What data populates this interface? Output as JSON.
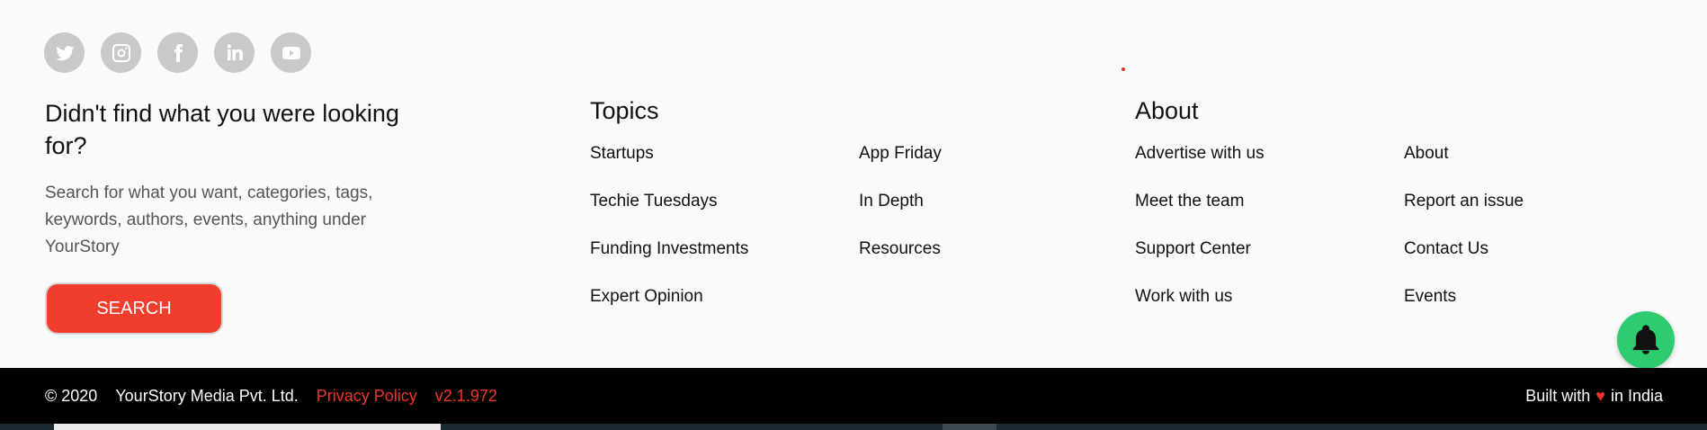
{
  "social": [
    {
      "name": "twitter-icon",
      "glyph": "twitter"
    },
    {
      "name": "instagram-icon",
      "glyph": "instagram"
    },
    {
      "name": "facebook-icon",
      "glyph": "f"
    },
    {
      "name": "linkedin-icon",
      "glyph": "in"
    },
    {
      "name": "youtube-icon",
      "glyph": "youtube"
    }
  ],
  "search": {
    "heading": "Didn't find what you were looking for?",
    "description": "Search for what you want, categories, tags, keywords, authors, events, anything under YourStory",
    "button_label": "SEARCH"
  },
  "topics": {
    "title": "Topics",
    "col1": [
      "Startups",
      "Techie Tuesdays",
      "Funding Investments",
      "Expert Opinion"
    ],
    "col2": [
      "App Friday",
      "In Depth",
      "Resources"
    ]
  },
  "about": {
    "title": "About",
    "col1": [
      "Advertise with us",
      "Meet the team",
      "Support Center",
      "Work with us"
    ],
    "col2": [
      "About",
      "Report an issue",
      "Contact Us",
      "Events"
    ]
  },
  "footer": {
    "copyright": "© 2020",
    "company": "YourStory Media Pvt. Ltd.",
    "privacy": "Privacy Policy",
    "version": "v2.1.972",
    "built_with": "Built with",
    "heart": "♥",
    "in_india": "in India"
  },
  "colors": {
    "accent": "#f03d2d",
    "bell": "#2ecc71",
    "footer_bg": "#000000"
  }
}
